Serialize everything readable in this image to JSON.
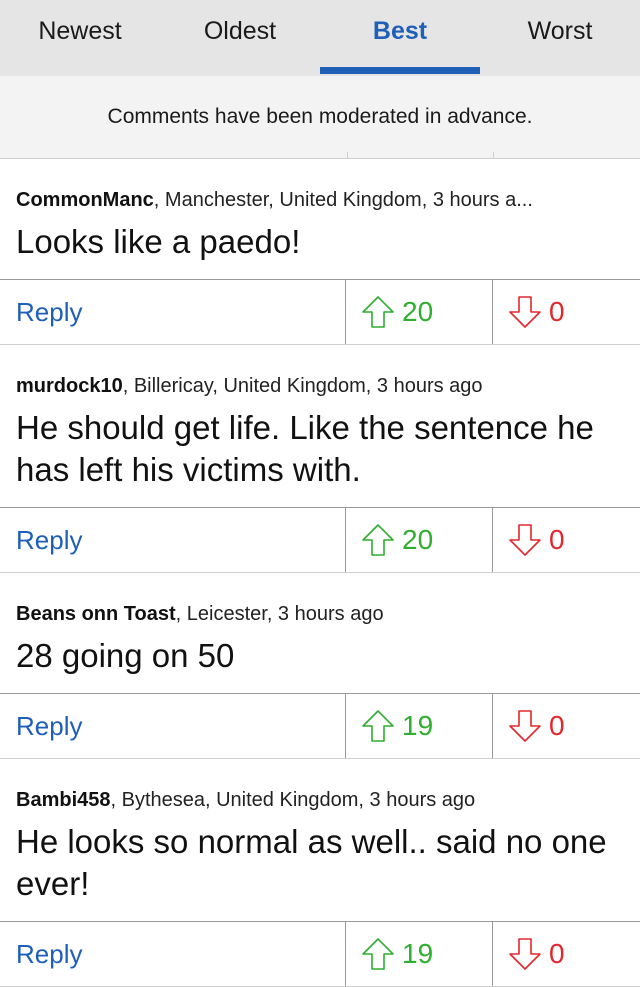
{
  "tabs": [
    {
      "label": "Newest"
    },
    {
      "label": "Oldest"
    },
    {
      "label": "Best"
    },
    {
      "label": "Worst"
    }
  ],
  "active_tab": "Best",
  "notice": "Comments have been moderated in advance.",
  "colors": {
    "accent": "#1f5fb8",
    "upvote": "#2fae2f",
    "downvote": "#e2282e"
  },
  "comments": [
    {
      "author": "CommonManc",
      "location": ", Manchester, United Kingdom, 3 hours a...",
      "text": "Looks like a paedo!",
      "reply": "Reply",
      "up": "20",
      "down": "0"
    },
    {
      "author": "murdock10",
      "location": ", Billericay, United Kingdom, 3 hours ago",
      "text": "He should get life. Like the sentence he has left his victims with.",
      "reply": "Reply",
      "up": "20",
      "down": "0"
    },
    {
      "author": "Beans onn Toast",
      "location": ", Leicester, 3 hours ago",
      "text": "28 going on 50",
      "reply": "Reply",
      "up": "19",
      "down": "0"
    },
    {
      "author": "Bambi458",
      "location": ", Bythesea, United Kingdom, 3 hours ago",
      "text": "He looks so normal as well.. said no one ever!",
      "reply": "Reply",
      "up": "19",
      "down": "0"
    }
  ]
}
